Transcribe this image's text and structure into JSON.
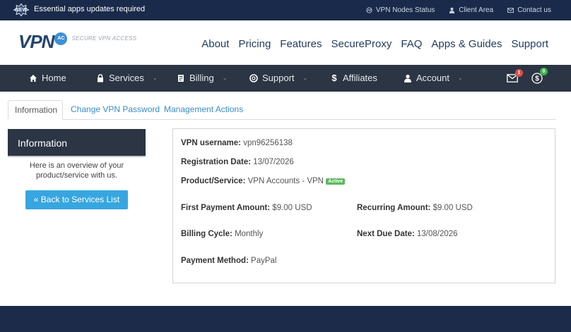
{
  "topbar": {
    "new_badge": "NEW",
    "announcement": "Essential apps updates required",
    "links": [
      {
        "label": "VPN Nodes Status",
        "icon": "status-icon"
      },
      {
        "label": "Client Area",
        "icon": "user-icon"
      },
      {
        "label": "Contact us",
        "icon": "mail-icon"
      }
    ]
  },
  "header": {
    "logo_text": "VPN",
    "logo_badge": "AC",
    "logo_tagline": "SECURE VPN ACCESS",
    "nav": [
      "About",
      "Pricing",
      "Features",
      "SecureProxy",
      "FAQ",
      "Apps & Guides",
      "Support"
    ]
  },
  "darknav": {
    "items": [
      {
        "label": "Home",
        "icon": "home-icon",
        "dropdown": false
      },
      {
        "label": "Services",
        "icon": "lock-icon",
        "dropdown": true
      },
      {
        "label": "Billing",
        "icon": "billing-icon",
        "dropdown": true
      },
      {
        "label": "Support",
        "icon": "lifebuoy-icon",
        "dropdown": true
      },
      {
        "label": "Affiliates",
        "icon": "dollar-icon",
        "dropdown": false
      },
      {
        "label": "Account",
        "icon": "user-icon",
        "dropdown": true
      }
    ],
    "mail_count": "1",
    "credit_count": "0"
  },
  "tabs": [
    "Information",
    "Change VPN Password",
    "Management Actions"
  ],
  "sidebar": {
    "title": "Information",
    "description_line1": "Here is an overview of your",
    "description_line2": "product/service with us.",
    "back_button": "« Back to Services List"
  },
  "info": {
    "username_label": "VPN username:",
    "username_value": "vpn96256138",
    "registration_label": "Registration Date:",
    "registration_value": "13/07/2026",
    "product_label": "Product/Service:",
    "product_value": "VPN Accounts - VPN",
    "status_badge": "Active",
    "first_payment_label": "First Payment Amount:",
    "first_payment_value": "$9.00 USD",
    "recurring_label": "Recurring Amount:",
    "recurring_value": "$9.00 USD",
    "billing_cycle_label": "Billing Cycle:",
    "billing_cycle_value": "Monthly",
    "next_due_label": "Next Due Date:",
    "next_due_value": "13/08/2026",
    "payment_method_label": "Payment Method:",
    "payment_method_value": "PayPal"
  },
  "colors": {
    "topbar": "#1a2a4a",
    "navbar": "#2b3543",
    "link": "#3a8cc9",
    "button": "#37a6e0",
    "active_badge": "#5cb85c"
  }
}
